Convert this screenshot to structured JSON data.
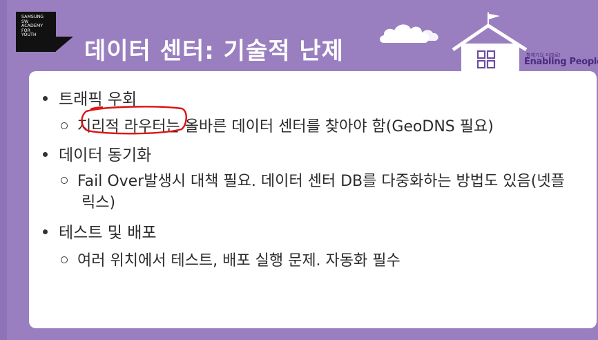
{
  "header": {
    "logo_lines": [
      "SAMSUNG",
      "SW",
      "ACADEMY",
      "FOR",
      "YOUTH"
    ],
    "title": "데이터 센터: 기술적 난제",
    "brand_tagline": "함께가요 미래로!",
    "brand_name": "Enabling People"
  },
  "content": {
    "bullets": [
      {
        "label": "트래픽 우회",
        "sub": [
          "지리적 라우터는 올바른 데이터 센터를 찾아야 함(GeoDNS 필요)"
        ]
      },
      {
        "label": "데이터 동기화",
        "sub": [
          "Fail Over발생시 대책 필요. 데이터 센터 DB를 다중화하는 방법도 있음(넷플릭스)"
        ]
      },
      {
        "label": "테스트 및 배포",
        "sub": [
          "여러 위치에서 테스트, 배포 실행 문제. 자동화 필수"
        ]
      }
    ]
  },
  "colors": {
    "header_bg": "#9a7fc0",
    "brand_purple": "#4a2a80",
    "annotation_red": "#e01010"
  },
  "icons": [
    "cloud-icon",
    "school-house-icon"
  ]
}
